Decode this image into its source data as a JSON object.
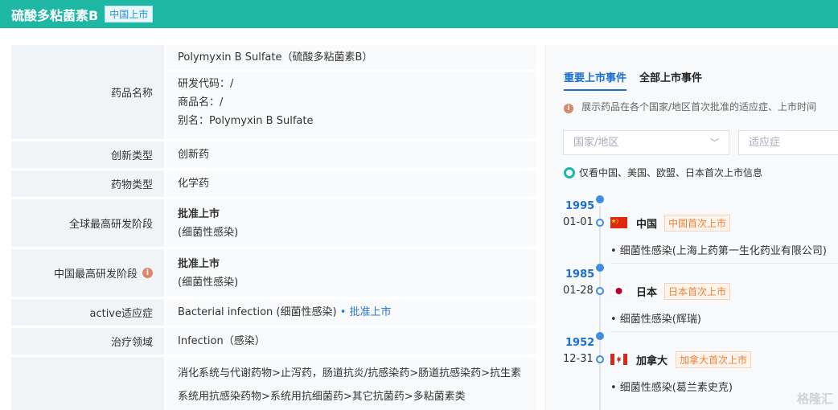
{
  "header": {
    "title": "硫酸多粘菌素B",
    "badge": "中国上市"
  },
  "fields": {
    "drug_name": {
      "label": "药品名称",
      "main_name": "Polymyxin B Sulfate（硫酸多粘菌素B）",
      "code": "研发代码：/",
      "trade_name": "商品名：/",
      "alias": "别名：Polymyxin B Sulfate"
    },
    "innovation": {
      "label": "创新类型",
      "value": "创新药"
    },
    "drug_type": {
      "label": "药物类型",
      "value": "化学药"
    },
    "global_stage": {
      "label": "全球最高研发阶段",
      "value": "批准上市",
      "sub": "(细菌性感染)"
    },
    "china_stage": {
      "label": "中国最高研发阶段",
      "value": "批准上市",
      "sub": "(细菌性感染)"
    },
    "active_indication": {
      "label": "active适应症",
      "value": "Bacterial infection (细菌性感染)",
      "status": "• 批准上市"
    },
    "therapy_area": {
      "label": "治疗领域",
      "value": "Infection（感染）"
    },
    "classification": {
      "line1": "消化系统与代谢药物>止泻药，肠道抗炎/抗感染药>肠道抗感染药>抗生素",
      "line2": "系统用抗感染药物>系统用抗细菌药>其它抗菌药>多粘菌素类"
    }
  },
  "right_panel": {
    "tabs": [
      "重要上市事件",
      "全部上市事件"
    ],
    "note": "展示药品在各个国家/地区首次批准的适应症、上市时间",
    "country_select": {
      "placeholder": "国家/地区"
    },
    "indication_select": {
      "placeholder": "适应症"
    },
    "checkbox_label": "仅看中国、美国、欧盟、日本首次上市信息",
    "events": [
      {
        "year": "1995",
        "date": "01-01",
        "country": "中国",
        "tag": "中国首次上市",
        "detail": "• 细菌性感染(上海上药第一生化药业有限公司)"
      },
      {
        "year": "1985",
        "date": "01-28",
        "country": "日本",
        "tag": "日本首次上市",
        "detail": "• 细菌性感染(辉瑞)"
      },
      {
        "year": "1952",
        "date": "12-31",
        "country": "加拿大",
        "tag": "加拿大首次上市",
        "detail": "• 细菌性感染(葛兰素史克)"
      }
    ]
  },
  "watermark": "格隆汇"
}
